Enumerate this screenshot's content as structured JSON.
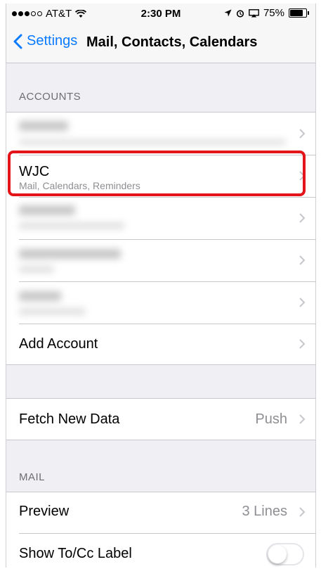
{
  "status": {
    "carrier": "AT&T",
    "time": "2:30 PM",
    "battery": "75%",
    "battery_level": 0.75
  },
  "nav": {
    "back_label": "Settings",
    "title": "Mail, Contacts, Calendars"
  },
  "accounts": {
    "header": "ACCOUNTS",
    "items": [
      {
        "title": "",
        "subtitle": ""
      },
      {
        "title": "WJC",
        "subtitle": "Mail, Calendars, Reminders"
      },
      {
        "title": "",
        "subtitle": ""
      },
      {
        "title": "",
        "subtitle": ""
      },
      {
        "title": "",
        "subtitle": ""
      }
    ],
    "add_account": "Add Account"
  },
  "fetch": {
    "label": "Fetch New Data",
    "value": "Push"
  },
  "mail": {
    "header": "MAIL",
    "preview_label": "Preview",
    "preview_value": "3 Lines",
    "show_tocc_label": "Show To/Cc Label",
    "show_tocc_on": false
  },
  "colors": {
    "accent": "#0a7aff",
    "highlight": "#e3151a"
  }
}
